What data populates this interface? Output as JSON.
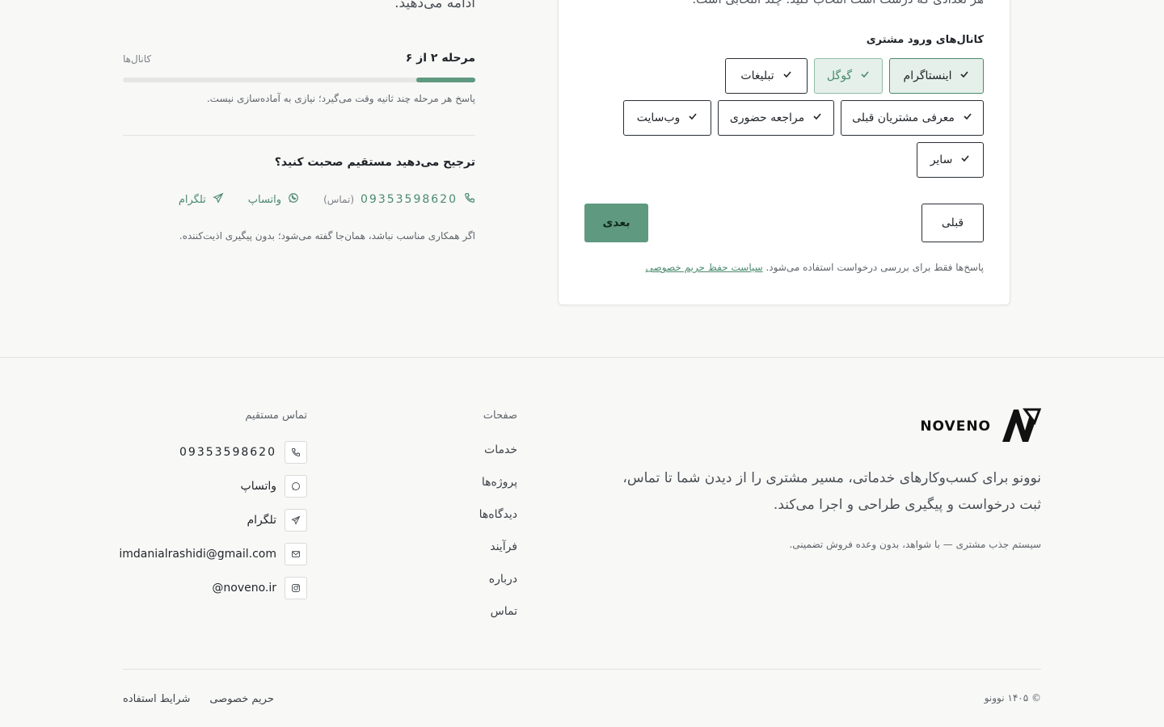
{
  "intro": {
    "continue_text": "ادامه می‌دهید."
  },
  "progress": {
    "step_label": "مرحله ۲ از ۶",
    "section_label": "کانال‌ها",
    "fraction": 0.167,
    "note": "پاسخ هر مرحله چند ثانیه وقت می‌گیرد؛ نیازی به آماده‌سازی نیست."
  },
  "direct": {
    "question": "ترجیح می‌دهید مستقیم صحبت کنید؟",
    "phone": "09353598620",
    "phone_hint": "(تماس)",
    "whatsapp": "واتساپ",
    "telegram": "تلگرام",
    "note": "اگر همکاری مناسب نباشد، همان‌جا گفته می‌شود؛ بدون پیگیری اذیت‌کننده."
  },
  "form": {
    "top_text": "هر تعدادی که درست است انتخاب کنید؛ چند انتخابی است.",
    "channels_label": "کانال‌های ورود مشتری",
    "chips": [
      {
        "label": "اینستاگرام",
        "state": "selected"
      },
      {
        "label": "گوگل",
        "state": "selected-soft"
      },
      {
        "label": "تبلیغات",
        "state": "default"
      },
      {
        "label": "معرفی مشتریان قبلی",
        "state": "default"
      },
      {
        "label": "مراجعه حضوری",
        "state": "default"
      },
      {
        "label": "وب‌سایت",
        "state": "default"
      },
      {
        "label": "سایر",
        "state": "default"
      }
    ],
    "prev_label": "قبلی",
    "next_label": "بعدی",
    "privacy_prefix": "پاسخ‌ها فقط برای بررسی درخواست استفاده می‌شود.",
    "privacy_link": "سیاست حفظ حریم خصوصی"
  },
  "footer": {
    "brand": "NOVENO",
    "description": "نوونو برای کسب‌وکارهای خدماتی، مسیر مشتری را از دیدن شما تا تماس، ثبت درخواست و پیگیری طراحی و اجرا می‌کند.",
    "tagline": "سیستم جذب مشتری — با شواهد، بدون وعده فروش تضمینی.",
    "pages_title": "صفحات",
    "pages": [
      "خدمات",
      "پروژه‌ها",
      "دیدگاه‌ها",
      "فرآیند",
      "درباره",
      "تماس"
    ],
    "contact_title": "تماس مستقیم",
    "contacts": [
      {
        "icon": "phone-icon",
        "text": "09353598620"
      },
      {
        "icon": "whatsapp-icon",
        "text": "واتساپ"
      },
      {
        "icon": "telegram-icon",
        "text": "تلگرام"
      },
      {
        "icon": "mail-icon",
        "text": "imdanialrashidi@gmail.com"
      },
      {
        "icon": "instagram-icon",
        "text": "noveno.ir@"
      }
    ],
    "copyright": "© ۱۴۰۵ نوونو",
    "privacy": "حریم خصوصی",
    "terms": "شرایط استفاده"
  },
  "colors": {
    "accent": "#5f9980",
    "accent_text": "#4b8a6e",
    "selected_bg": "#e4f0e9"
  }
}
